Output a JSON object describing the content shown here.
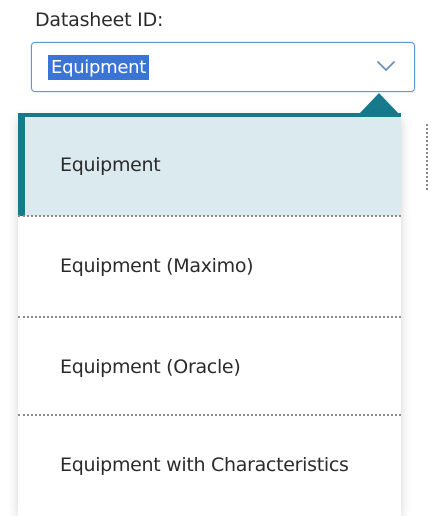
{
  "field": {
    "label": "Datasheet ID:",
    "selected_value": "Equipment"
  },
  "dropdown": {
    "options": [
      {
        "label": "Equipment",
        "selected": true
      },
      {
        "label": "Equipment (Maximo)",
        "selected": false
      },
      {
        "label": "Equipment (Oracle)",
        "selected": false
      },
      {
        "label": "Equipment with Characteristics",
        "selected": false
      }
    ]
  },
  "icons": {
    "dropdown_toggle": "chevron-down-icon"
  },
  "colors": {
    "accent_teal": "#167a8c",
    "selected_row_bg": "#daeaef",
    "text_highlight": "#3a74d4",
    "select_border": "#5b9bd5"
  }
}
